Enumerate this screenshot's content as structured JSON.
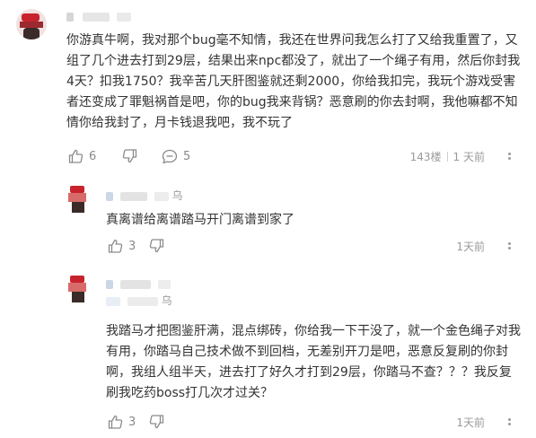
{
  "comments": [
    {
      "username": "",
      "text": "你游真牛啊，我对那个bug毫不知情，我还在世界问我怎么打了又给我重置了，又组了几个进去打到29层，结果出来npc都没了，就出了一个绳子有用，然后你封我4天？扣我1750？我辛苦几天肝图鉴就还剩2000，你给我扣完，我玩个游戏受害者还变成了罪魁祸首是吧，你的bug我来背锅？恶意刷的你去封啊，我他嘛都不知情你给我封了，月卡钱退我吧，我不玩了",
      "likes": "6",
      "replies": "5",
      "floor": "143楼",
      "time": "1 天前"
    }
  ],
  "replies": [
    {
      "username": "乌",
      "text": "真离谱给离谱踏马开门离谱到家了",
      "likes": "3",
      "time": "1天前"
    },
    {
      "username": "乌",
      "text": "我踏马才把图鉴肝满，混点绑砖，你给我一下干没了，就一个金色绳子对我有用，你踏马自己技术做不到回档，无差别开刀是吧，恶意反复刷的你封啊，我组人组半天，进去打了好久才打到29层，你踏马不查？？？我反复刷我吃药boss打几次才过关？",
      "likes": "3",
      "time": "1天前"
    }
  ],
  "colors": {
    "text": "#333333",
    "meta": "#9a9a9a",
    "icon": "#8a8a8a",
    "avatar_red": "#c8232c",
    "avatar_dark": "#3a2a28"
  }
}
